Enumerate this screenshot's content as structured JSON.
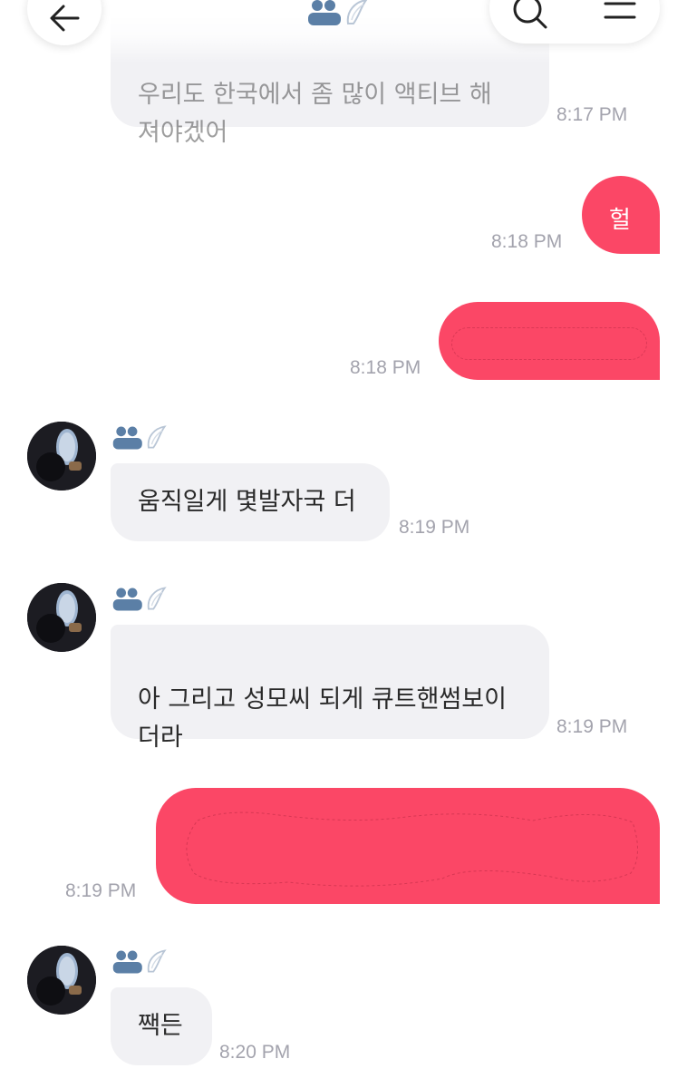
{
  "messages": [
    {
      "id": "m1",
      "direction": "incoming",
      "text": "우리도 한국에서 좀 많이 액티브 해\n져야겠어",
      "time": "8:17 PM"
    },
    {
      "id": "m2",
      "direction": "outgoing",
      "text": "헐",
      "time": "8:18 PM"
    },
    {
      "id": "m3",
      "direction": "outgoing",
      "text": "",
      "redacted": true,
      "time": "8:18 PM"
    },
    {
      "id": "m4",
      "direction": "incoming",
      "text": "움직일게 몇발자국 더",
      "time": "8:19 PM"
    },
    {
      "id": "m5",
      "direction": "incoming",
      "text": "아 그리고 성모씨 되게 큐트핸썸보이\n더라",
      "time": "8:19 PM"
    },
    {
      "id": "m6",
      "direction": "outgoing",
      "text": "",
      "redacted": true,
      "time": "8:19 PM"
    },
    {
      "id": "m7",
      "direction": "incoming",
      "text": "짹든",
      "time": "8:20 PM"
    }
  ],
  "icons": {
    "back": "arrow-left-icon",
    "search": "search-icon",
    "menu": "hamburger-menu-icon",
    "sender_badge": "people-wing-icon"
  },
  "colors": {
    "outgoing_bubble": "#fb4766",
    "incoming_bubble": "#f1f1f4",
    "timestamp": "#a3a3ad"
  }
}
